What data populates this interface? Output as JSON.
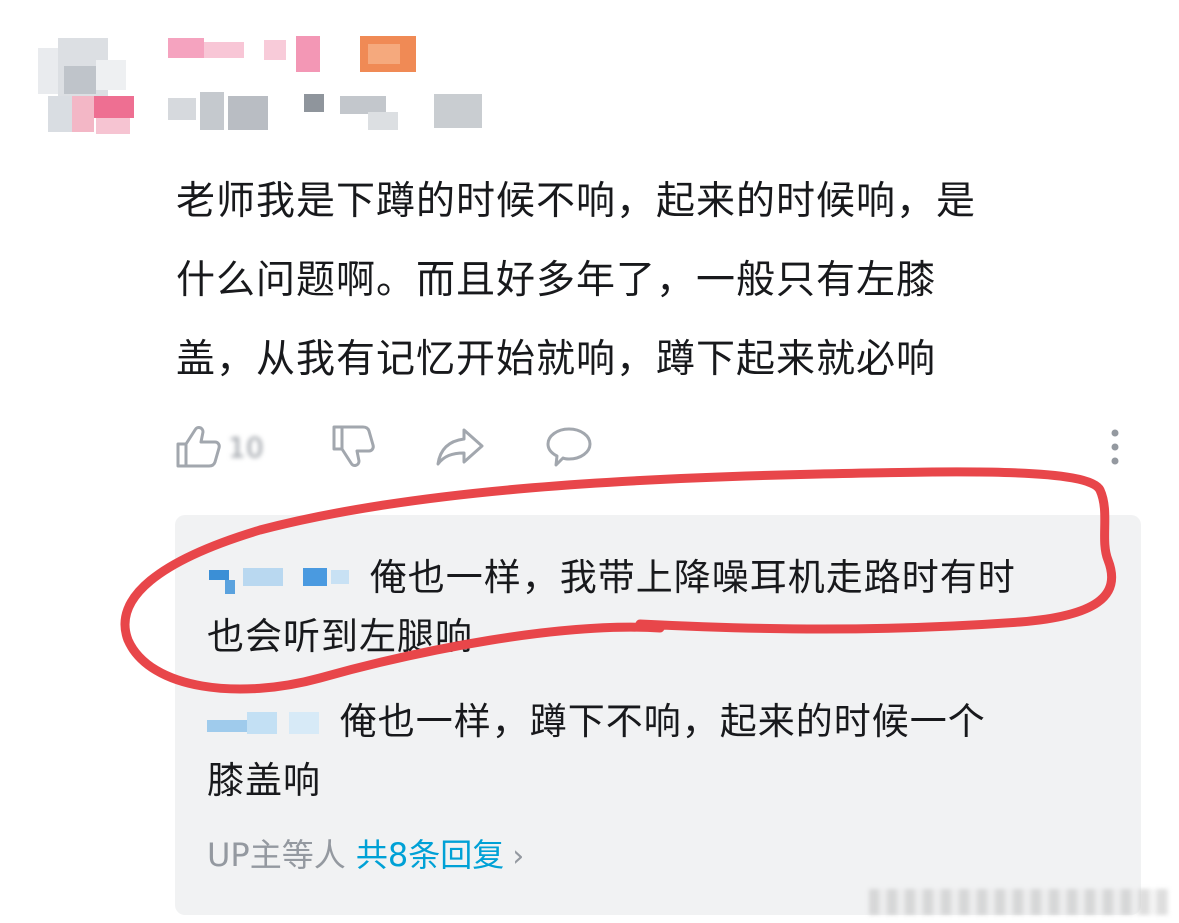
{
  "comment": {
    "lines": [
      "老师我是下蹲的时候不响，起来的时候响，是",
      "什么问题啊。而且好多年了，一般只有左膝",
      "盖，从我有记忆开始就响，蹲下起来就必响"
    ]
  },
  "actions": {
    "like_icon": "thumbs-up-icon",
    "dislike_icon": "thumbs-down-icon",
    "share_icon": "share-icon",
    "reply_icon": "speech-bubble-icon",
    "more_icon": "vertical-ellipsis-icon",
    "like_count": "10"
  },
  "replies": [
    {
      "text": "俺也一样，我带上降噪耳机走路时有时",
      "text2": "也会听到左腿响"
    },
    {
      "text": "俺也一样，蹲下不响，起来的时候一个",
      "text2": "膝盖响"
    }
  ],
  "more_replies": {
    "prefix": "UP主等人 ",
    "count_text": "共8条回复",
    "chevron": "›"
  },
  "colors": {
    "highlight_red": "#e8464a",
    "link_blue": "#00a1d6",
    "meta_gray": "#9499a0",
    "reply_bg": "#f1f2f3"
  }
}
